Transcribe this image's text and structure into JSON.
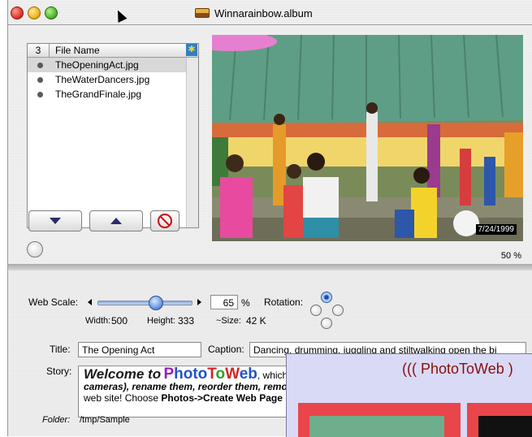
{
  "window": {
    "title": "Winnarainbow.album"
  },
  "file_list": {
    "count": "3",
    "column_header": "File Name",
    "files": [
      {
        "name": "TheOpeningAct.jpg",
        "selected": true
      },
      {
        "name": "TheWaterDancers.jpg",
        "selected": false
      },
      {
        "name": "TheGrandFinale.jpg",
        "selected": false
      }
    ]
  },
  "preview": {
    "date_stamp": "7/24/1999",
    "zoom": "50 %"
  },
  "web_scale": {
    "label": "Web Scale:",
    "value": "65",
    "unit": "%",
    "slider_fraction": 0.65,
    "width_label": "Width:",
    "width": "500",
    "height_label": "Height:",
    "height": "333",
    "size_label": "~Size:",
    "size": "42 K"
  },
  "rotation": {
    "label": "Rotation:",
    "selected": "top"
  },
  "meta": {
    "title_label": "Title:",
    "title_value": "The Opening Act",
    "caption_label": "Caption:",
    "caption_value": "Dancing, drumming, juggling and stiltwalking open the bi",
    "story_label": "Story:",
    "folder_label": "Folder:",
    "folder_value": "/tmp/Sample"
  },
  "story": {
    "welcome": "Welcome to",
    "brand_letters": [
      "P",
      "hoto",
      "T",
      "o",
      "W",
      "eb"
    ],
    "line1_tail": ", which",
    "line2": "cameras), rename them, reorder them, remove",
    "line3_pre": "web site! Choose ",
    "line3_bold": "Photos->Create Web Page"
  },
  "popup": {
    "title": "((( PhotoToWeb )"
  },
  "colors": {
    "accent": "#2f5fb0",
    "brand_purple": "#9b1dbf",
    "brand_blue": "#1f53c9",
    "brand_red": "#d52424",
    "brand_green": "#2da028"
  }
}
